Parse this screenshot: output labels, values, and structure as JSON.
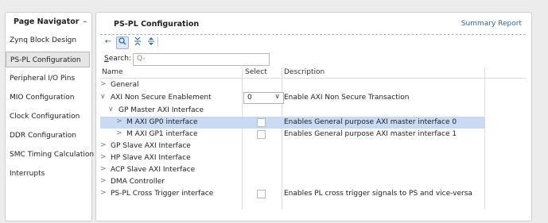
{
  "navigator": {
    "title": "Page Navigator",
    "minimize": "–",
    "items": [
      {
        "label": "Zynq Block Design"
      },
      {
        "label": "PS-PL Configuration"
      },
      {
        "label": "Peripheral I/O Pins"
      },
      {
        "label": "MIO Configuration"
      },
      {
        "label": "Clock Configuration"
      },
      {
        "label": "DDR Configuration"
      },
      {
        "label": "SMC Timing Calculation"
      },
      {
        "label": "Interrupts"
      }
    ],
    "selected": "PS-PL Configuration"
  },
  "main": {
    "title": "PS-PL Configuration",
    "summary_link": "Summary Report",
    "toolbar": {
      "back_icon": "←",
      "search_icon": "🔍",
      "collapse_icon": "⇟",
      "expand_icon": "⇳"
    },
    "search": {
      "label": "earch:",
      "label_underlined": "S",
      "placeholder": "Q-"
    },
    "table": {
      "headers": {
        "name": "Name",
        "select": "Select",
        "description": "Description"
      },
      "rows": [
        {
          "chevron": ">",
          "name": "General",
          "select": "",
          "description": ""
        },
        {
          "chevron": "∨",
          "name": "AXI Non Secure Enablement",
          "select": "0",
          "description": "Enable AXI Non Secure Transaction"
        },
        {
          "chevron": "∨",
          "name": "GP Master AXI Interface",
          "select": "",
          "description": ""
        },
        {
          "chevron": ">",
          "name": "M AXI GP0 interface",
          "select": "checkbox",
          "description": "Enables General purpose AXI master interface 0"
        },
        {
          "chevron": ">",
          "name": "M AXI GP1 interface",
          "select": "checkbox",
          "description": "Enables General purpose AXI master interface 1"
        },
        {
          "chevron": ">",
          "name": "GP Slave AXI Interface",
          "select": "",
          "description": ""
        },
        {
          "chevron": ">",
          "name": "HP Slave AXI Interface",
          "select": "",
          "description": ""
        },
        {
          "chevron": ">",
          "name": "ACP Slave AXI Interface",
          "select": "",
          "description": ""
        },
        {
          "chevron": ">",
          "name": "DMA Controller",
          "select": "",
          "description": ""
        },
        {
          "chevron": ">",
          "name": "PS-PL Cross Trigger interface",
          "select": "checkbox",
          "description": "Enables PL cross trigger signals to PS and vice-versa"
        }
      ],
      "select_dropdown": {
        "value": "0",
        "arrow": "∨"
      }
    }
  }
}
